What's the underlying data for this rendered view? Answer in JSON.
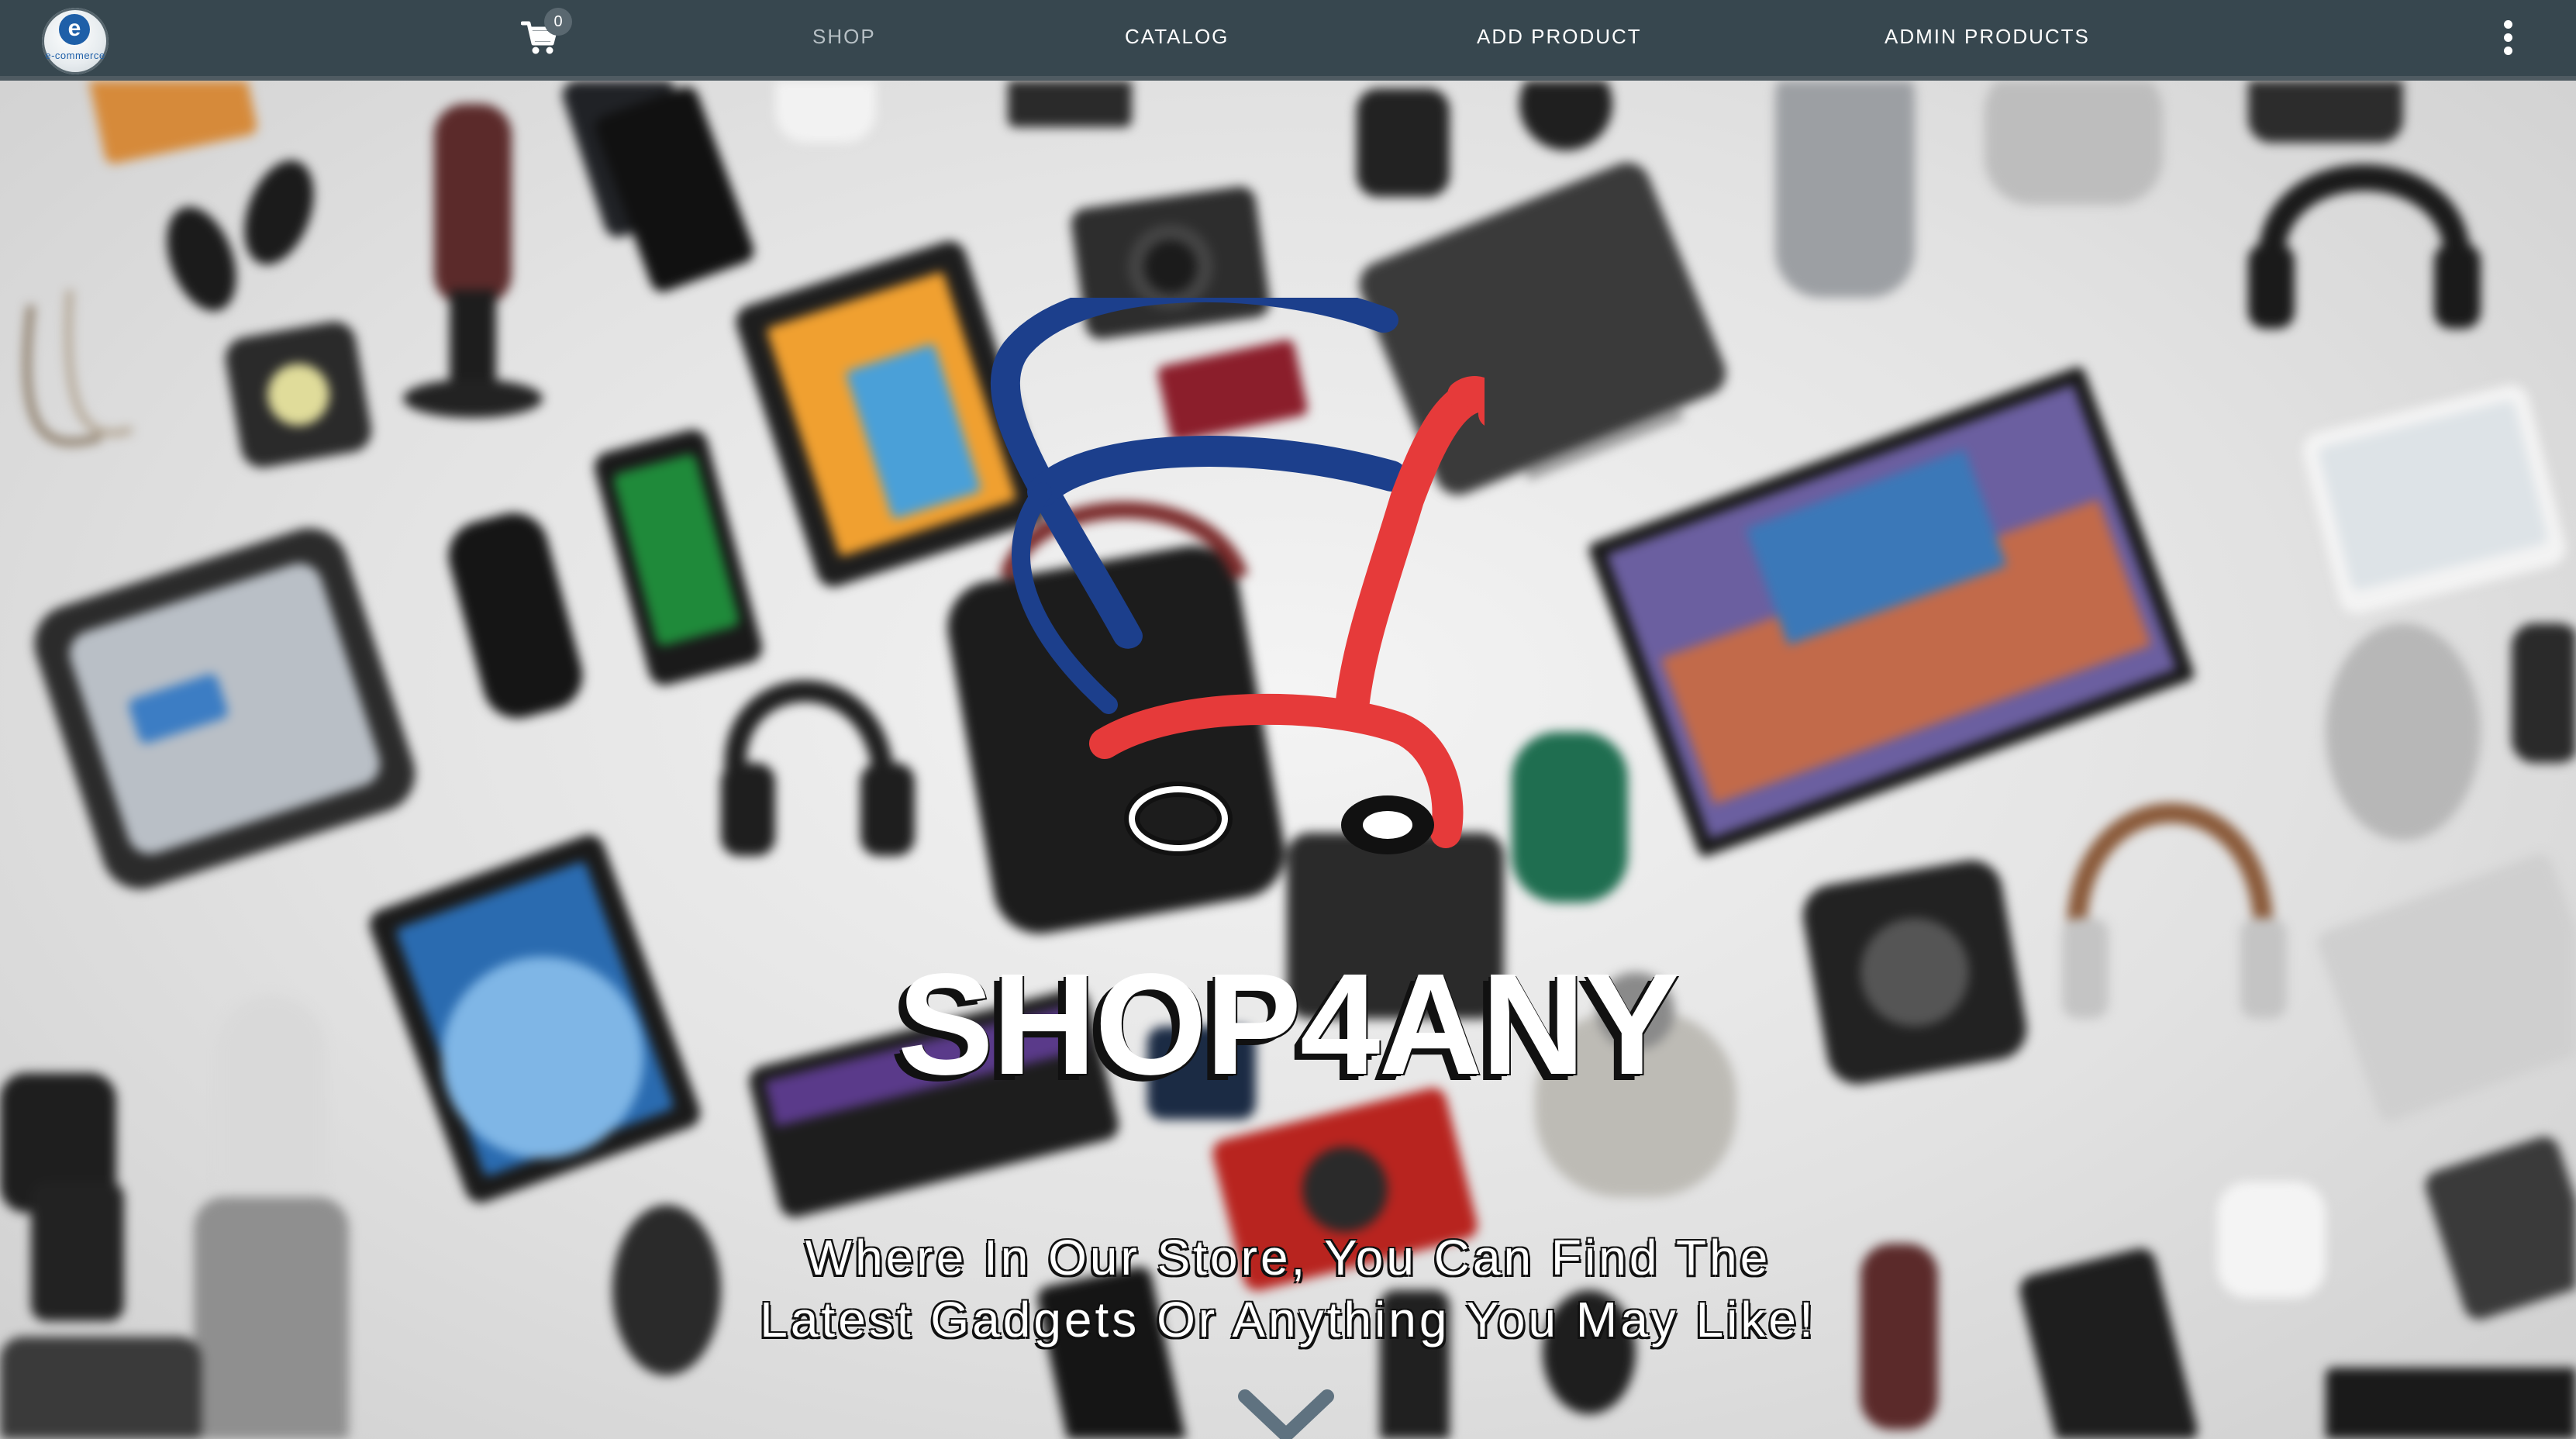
{
  "navbar": {
    "brand": {
      "logo_letter": "e",
      "logo_text": "e-commerce"
    },
    "cart": {
      "icon": "shopping-cart-icon",
      "count": "0"
    },
    "links": [
      {
        "label": "SHOP",
        "active": true
      },
      {
        "label": "CATALOG",
        "active": false
      },
      {
        "label": "ADD PRODUCT",
        "active": false
      },
      {
        "label": "ADMIN PRODUCTS",
        "active": false
      }
    ],
    "more_icon": "vertical-dots-icon",
    "background_color": "#37474f"
  },
  "hero": {
    "logo_icon": "shopping-cart-logo",
    "title": "SHOP4ANY",
    "subtitle_line1": "Where In Our Store, You Can Find The",
    "subtitle_line2": "Latest Gadgets Or Anything You May Like!",
    "scroll_icon": "chevron-down-icon",
    "brand_colors": {
      "red": "#e63a3a",
      "blue": "#1c3f8c",
      "chevron": "#5f7280"
    }
  }
}
